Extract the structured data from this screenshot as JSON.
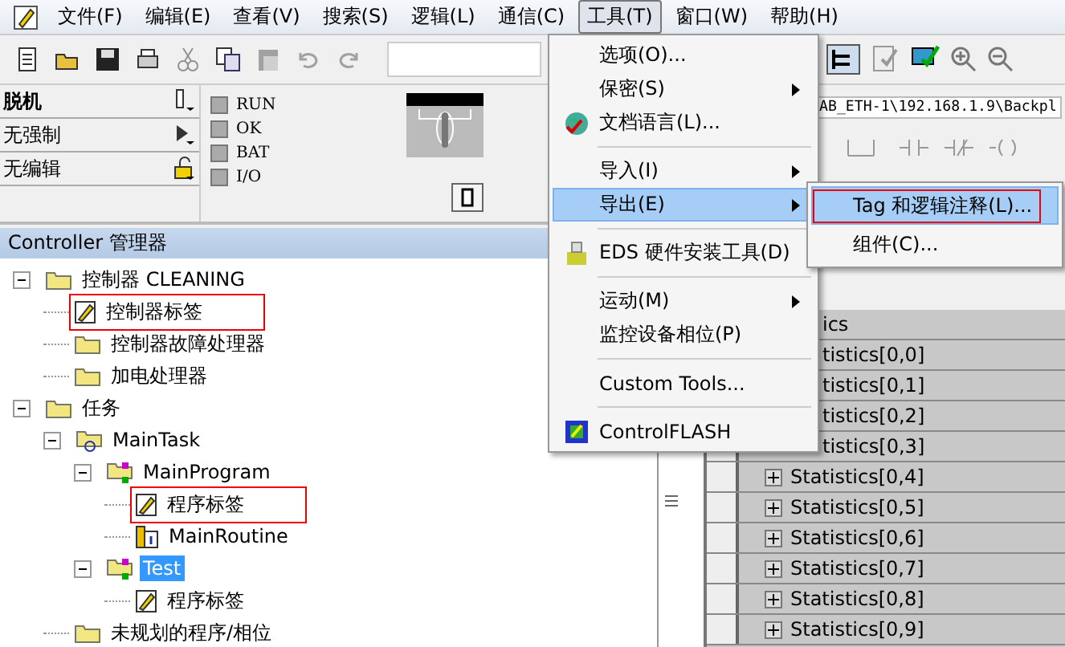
{
  "menubar": [
    {
      "label": "文件(F)",
      "selected": false
    },
    {
      "label": "编辑(E)",
      "selected": false
    },
    {
      "label": "查看(V)",
      "selected": false
    },
    {
      "label": "搜索(S)",
      "selected": false
    },
    {
      "label": "逻辑(L)",
      "selected": false
    },
    {
      "label": "通信(C)",
      "selected": false
    },
    {
      "label": "工具(T)",
      "selected": true
    },
    {
      "label": "窗口(W)",
      "selected": false
    },
    {
      "label": "帮助(H)",
      "selected": false
    }
  ],
  "status_panel": {
    "modes": [
      {
        "label": "脱机",
        "kind": "key"
      },
      {
        "label": "无强制",
        "kind": "run"
      },
      {
        "label": "无编辑",
        "kind": "lock"
      }
    ],
    "leds": [
      "RUN",
      "OK",
      "BAT",
      "I/O"
    ]
  },
  "organizer": {
    "title": "Controller 管理器",
    "tree": [
      {
        "label": "控制器 CLEANING",
        "kind": "folder",
        "expanded": true,
        "selected": false,
        "annotated": false,
        "children": [
          {
            "label": "控制器标签",
            "kind": "tags",
            "selected": false,
            "annotated": true
          },
          {
            "label": "控制器故障处理器",
            "kind": "folder",
            "selected": false,
            "annotated": false
          },
          {
            "label": "加电处理器",
            "kind": "folder",
            "selected": false,
            "annotated": false
          }
        ]
      },
      {
        "label": "任务",
        "kind": "folder",
        "expanded": true,
        "selected": false,
        "annotated": false,
        "children": [
          {
            "label": "MainTask",
            "kind": "task",
            "expanded": true,
            "selected": false,
            "annotated": false,
            "children": [
              {
                "label": "MainProgram",
                "kind": "program",
                "expanded": true,
                "selected": false,
                "annotated": false,
                "children": [
                  {
                    "label": "程序标签",
                    "kind": "tags",
                    "selected": false,
                    "annotated": true
                  },
                  {
                    "label": "MainRoutine",
                    "kind": "routine",
                    "selected": false,
                    "annotated": false
                  }
                ]
              },
              {
                "label": "Test",
                "kind": "program",
                "expanded": true,
                "selected": true,
                "annotated": false,
                "children": [
                  {
                    "label": "程序标签",
                    "kind": "tags",
                    "selected": false,
                    "annotated": false
                  }
                ]
              }
            ]
          },
          {
            "label": "未规划的程序/相位",
            "kind": "folder",
            "selected": false,
            "annotated": false
          }
        ]
      }
    ]
  },
  "path_bar": {
    "text": "AB_ETH-1\\192.168.1.9\\Backpl"
  },
  "tag_table": {
    "header": "ics",
    "rows": [
      {
        "name": "tistics[0,0]",
        "kind": "partial"
      },
      {
        "name": "tistics[0,1]",
        "kind": "partial"
      },
      {
        "name": "tistics[0,2]",
        "kind": "partial"
      },
      {
        "name": "tistics[0,3]",
        "kind": "partial"
      },
      {
        "name": "Statistics[0,4]",
        "kind": "full"
      },
      {
        "name": "Statistics[0,5]",
        "kind": "full"
      },
      {
        "name": "Statistics[0,6]",
        "kind": "full"
      },
      {
        "name": "Statistics[0,7]",
        "kind": "full"
      },
      {
        "name": "Statistics[0,8]",
        "kind": "full"
      },
      {
        "name": "Statistics[0,9]",
        "kind": "full"
      }
    ]
  },
  "tools_menu": {
    "items": [
      {
        "label": "选项(O)...",
        "kind": "item",
        "submenu": false,
        "selected": false
      },
      {
        "label": "保密(S)",
        "kind": "item",
        "submenu": true,
        "selected": false
      },
      {
        "label": "文档语言(L)...",
        "kind": "globe",
        "submenu": false,
        "selected": false
      },
      {
        "kind": "separator"
      },
      {
        "label": "导入(I)",
        "kind": "item",
        "submenu": true,
        "selected": false
      },
      {
        "label": "导出(E)",
        "kind": "item",
        "submenu": true,
        "selected": true
      },
      {
        "kind": "separator"
      },
      {
        "label": "EDS 硬件安装工具(D)",
        "kind": "installer",
        "submenu": false,
        "selected": false
      },
      {
        "kind": "separator"
      },
      {
        "label": "运动(M)",
        "kind": "item",
        "submenu": true,
        "selected": false
      },
      {
        "label": "监控设备相位(P)",
        "kind": "item",
        "submenu": false,
        "selected": false
      },
      {
        "kind": "separator"
      },
      {
        "label": "Custom Tools...",
        "kind": "item",
        "submenu": false,
        "selected": false
      },
      {
        "kind": "separator"
      },
      {
        "label": "ControlFLASH",
        "kind": "chip",
        "submenu": false,
        "selected": false
      }
    ]
  },
  "export_submenu": {
    "items": [
      {
        "label": "Tag 和逻辑注释(L)...",
        "selected": true,
        "annotated": true
      },
      {
        "label": "组件(C)...",
        "selected": false,
        "annotated": false
      }
    ]
  }
}
